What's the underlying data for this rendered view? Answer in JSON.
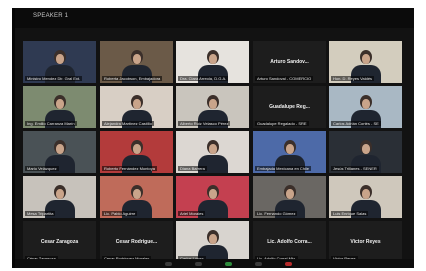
{
  "window": {
    "title": "SPEAKER 1"
  },
  "participants": [
    {
      "name": "",
      "tag": "Ministro Mendez Dir. Gral Ext.",
      "bg": "#2f3a52",
      "speaking": false
    },
    {
      "name": "",
      "tag": "Roberta Jacobson, Embajadora",
      "bg": "#6b5a48",
      "speaking": false
    },
    {
      "name": "",
      "tag": "Dra. Clara Arreola, D.G.A.",
      "bg": "#e6e3de",
      "speaking": false
    },
    {
      "name": "Arturo Sandov...",
      "tag": "Arturo Sandoval - COMERCIO",
      "bg": "#1d1d1d",
      "speaking": false
    },
    {
      "name": "",
      "tag": "Hon. D. Reyes Valdés",
      "bg": "#d3cdbe",
      "speaking": true
    },
    {
      "name": "",
      "tag": "Ing. Emilio Carranza Marín",
      "bg": "#7d8b70",
      "speaking": false
    },
    {
      "name": "",
      "tag": "Alejandra Martínez Castillo",
      "bg": "#d8cfc5",
      "speaking": false
    },
    {
      "name": "",
      "tag": "Alberto Ruiz Velasco Pérez",
      "bg": "#c9c5bd",
      "speaking": false
    },
    {
      "name": "Guadalupe Reg...",
      "tag": "Guadalupe Regalado - SRE",
      "bg": "#1d1d1d",
      "speaking": false
    },
    {
      "name": "",
      "tag": "Carlos Adrián Cortés - SE",
      "bg": "#a9b8c4",
      "speaking": false
    },
    {
      "name": "",
      "tag": "Mario Velázquez",
      "bg": "#4a5256",
      "speaking": false
    },
    {
      "name": "",
      "tag": "Roberto Fernández Montoya",
      "bg": "#b33b3b",
      "speaking": false
    },
    {
      "name": "",
      "tag": "Diana Barrera",
      "bg": "#dcd7d2",
      "speaking": false
    },
    {
      "name": "",
      "tag": "Embajada Mexicana en Chile",
      "bg": "#4d6aa8",
      "speaking": false
    },
    {
      "name": "",
      "tag": "Jesús Trillanes - SENER",
      "bg": "#2a2f36",
      "speaking": false
    },
    {
      "name": "",
      "tag": "Mesa Tripartita",
      "bg": "#c7c2bb",
      "speaking": false
    },
    {
      "name": "",
      "tag": "Lic. Pablo Aguirre",
      "bg": "#bf6b5a",
      "speaking": false
    },
    {
      "name": "",
      "tag": "Ariel Morales",
      "bg": "#c44050",
      "speaking": false
    },
    {
      "name": "",
      "tag": "Lic. Fernando Gómez",
      "bg": "#6a6763",
      "speaking": false
    },
    {
      "name": "",
      "tag": "Luis Enrique Salas",
      "bg": "#cfc8bc",
      "speaking": false
    },
    {
      "name": "Cesar Zaragoza",
      "tag": "César Zaragoza",
      "bg": "#1d1d1d",
      "speaking": false
    },
    {
      "name": "Cesar Rodrigue...",
      "tag": "Cesar Rodriguez Morales",
      "bg": "#1d1d1d",
      "speaking": false
    },
    {
      "name": "",
      "tag": "Carlos López",
      "bg": "#d8d4cf",
      "speaking": false
    },
    {
      "name": "Lic. Adolfo Corra...",
      "tag": "Lic. Adolfo Corral Mtz.",
      "bg": "#1d1d1d",
      "speaking": false
    },
    {
      "name": "Victor Reyes",
      "tag": "Victor Reyes",
      "bg": "#1d1d1d",
      "speaking": false
    }
  ]
}
